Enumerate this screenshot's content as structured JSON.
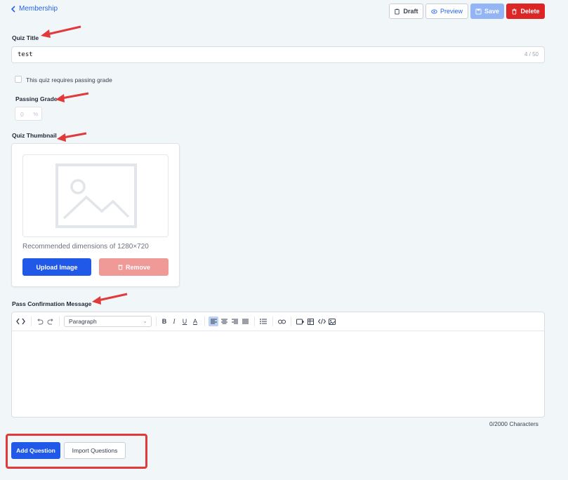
{
  "nav": {
    "back_label": "Membership"
  },
  "actions": {
    "draft": "Draft",
    "preview": "Preview",
    "save": "Save",
    "delete": "Delete"
  },
  "quiz_title": {
    "label": "Quiz Title",
    "value": "test",
    "counter": "4 / 50"
  },
  "passing": {
    "checkbox_label": "This quiz requires passing grade",
    "checked": false,
    "grade_label": "Passing Grade",
    "grade_value": "0",
    "grade_unit": "%"
  },
  "thumbnail": {
    "label": "Quiz Thumbnail",
    "recommendation": "Recommended dimensions of 1280×720",
    "upload_button": "Upload Image",
    "remove_button": "Remove"
  },
  "editor": {
    "label": "Pass Confirmation Message",
    "block_format": "Paragraph",
    "char_count": "0/2000 Characters"
  },
  "questions": {
    "add_button": "Add Question",
    "import_button": "Import Questions"
  },
  "colors": {
    "accent": "#2058e8",
    "danger": "#dc2626",
    "annotation": "#e03a3a"
  }
}
